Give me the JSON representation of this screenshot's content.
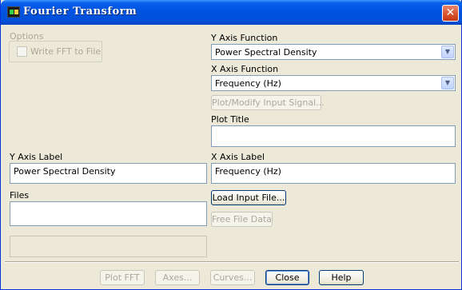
{
  "window": {
    "title": "Fourier Transform",
    "close_icon": "close-icon"
  },
  "options": {
    "group_label": "Options",
    "write_fft_label": "Write FFT to File",
    "write_fft_checked": false
  },
  "y_axis_function": {
    "label": "Y Axis Function",
    "value": "Power Spectral Density"
  },
  "x_axis_function": {
    "label": "X Axis Function",
    "value": "Frequency (Hz)"
  },
  "plot_modify_label": "Plot/Modify Input Signal...",
  "plot_title": {
    "label": "Plot Title",
    "value": ""
  },
  "y_axis_label": {
    "label": "Y Axis Label",
    "value": "Power Spectral Density"
  },
  "x_axis_label": {
    "label": "X Axis Label",
    "value": "Frequency (Hz)"
  },
  "files": {
    "label": "Files",
    "items": [],
    "status": ""
  },
  "load_input_label": "Load Input File...",
  "free_file_label": "Free File Data",
  "footer": {
    "plot_fft": "Plot FFT",
    "axes": "Axes...",
    "curves": "Curves...",
    "close": "Close",
    "help": "Help"
  }
}
